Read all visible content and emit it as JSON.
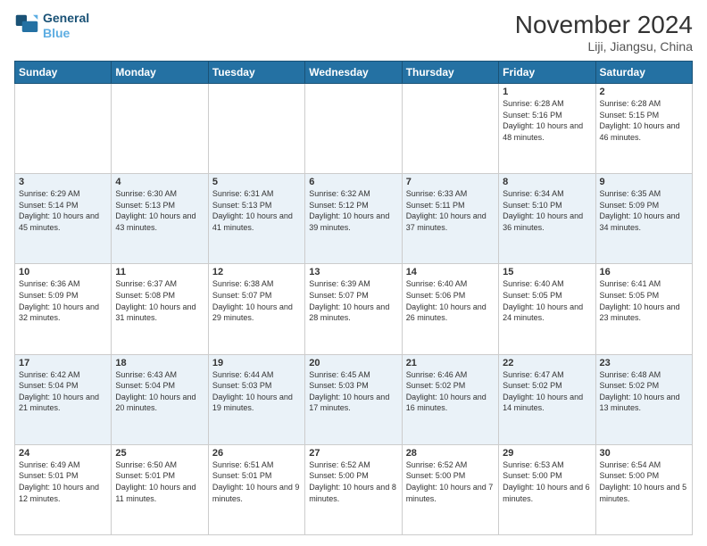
{
  "header": {
    "logo_line1": "General",
    "logo_line2": "Blue",
    "month_title": "November 2024",
    "location": "Liji, Jiangsu, China"
  },
  "days_of_week": [
    "Sunday",
    "Monday",
    "Tuesday",
    "Wednesday",
    "Thursday",
    "Friday",
    "Saturday"
  ],
  "weeks": [
    [
      {
        "day": "",
        "info": ""
      },
      {
        "day": "",
        "info": ""
      },
      {
        "day": "",
        "info": ""
      },
      {
        "day": "",
        "info": ""
      },
      {
        "day": "",
        "info": ""
      },
      {
        "day": "1",
        "info": "Sunrise: 6:28 AM\nSunset: 5:16 PM\nDaylight: 10 hours and 48 minutes."
      },
      {
        "day": "2",
        "info": "Sunrise: 6:28 AM\nSunset: 5:15 PM\nDaylight: 10 hours and 46 minutes."
      }
    ],
    [
      {
        "day": "3",
        "info": "Sunrise: 6:29 AM\nSunset: 5:14 PM\nDaylight: 10 hours and 45 minutes."
      },
      {
        "day": "4",
        "info": "Sunrise: 6:30 AM\nSunset: 5:13 PM\nDaylight: 10 hours and 43 minutes."
      },
      {
        "day": "5",
        "info": "Sunrise: 6:31 AM\nSunset: 5:13 PM\nDaylight: 10 hours and 41 minutes."
      },
      {
        "day": "6",
        "info": "Sunrise: 6:32 AM\nSunset: 5:12 PM\nDaylight: 10 hours and 39 minutes."
      },
      {
        "day": "7",
        "info": "Sunrise: 6:33 AM\nSunset: 5:11 PM\nDaylight: 10 hours and 37 minutes."
      },
      {
        "day": "8",
        "info": "Sunrise: 6:34 AM\nSunset: 5:10 PM\nDaylight: 10 hours and 36 minutes."
      },
      {
        "day": "9",
        "info": "Sunrise: 6:35 AM\nSunset: 5:09 PM\nDaylight: 10 hours and 34 minutes."
      }
    ],
    [
      {
        "day": "10",
        "info": "Sunrise: 6:36 AM\nSunset: 5:09 PM\nDaylight: 10 hours and 32 minutes."
      },
      {
        "day": "11",
        "info": "Sunrise: 6:37 AM\nSunset: 5:08 PM\nDaylight: 10 hours and 31 minutes."
      },
      {
        "day": "12",
        "info": "Sunrise: 6:38 AM\nSunset: 5:07 PM\nDaylight: 10 hours and 29 minutes."
      },
      {
        "day": "13",
        "info": "Sunrise: 6:39 AM\nSunset: 5:07 PM\nDaylight: 10 hours and 28 minutes."
      },
      {
        "day": "14",
        "info": "Sunrise: 6:40 AM\nSunset: 5:06 PM\nDaylight: 10 hours and 26 minutes."
      },
      {
        "day": "15",
        "info": "Sunrise: 6:40 AM\nSunset: 5:05 PM\nDaylight: 10 hours and 24 minutes."
      },
      {
        "day": "16",
        "info": "Sunrise: 6:41 AM\nSunset: 5:05 PM\nDaylight: 10 hours and 23 minutes."
      }
    ],
    [
      {
        "day": "17",
        "info": "Sunrise: 6:42 AM\nSunset: 5:04 PM\nDaylight: 10 hours and 21 minutes."
      },
      {
        "day": "18",
        "info": "Sunrise: 6:43 AM\nSunset: 5:04 PM\nDaylight: 10 hours and 20 minutes."
      },
      {
        "day": "19",
        "info": "Sunrise: 6:44 AM\nSunset: 5:03 PM\nDaylight: 10 hours and 19 minutes."
      },
      {
        "day": "20",
        "info": "Sunrise: 6:45 AM\nSunset: 5:03 PM\nDaylight: 10 hours and 17 minutes."
      },
      {
        "day": "21",
        "info": "Sunrise: 6:46 AM\nSunset: 5:02 PM\nDaylight: 10 hours and 16 minutes."
      },
      {
        "day": "22",
        "info": "Sunrise: 6:47 AM\nSunset: 5:02 PM\nDaylight: 10 hours and 14 minutes."
      },
      {
        "day": "23",
        "info": "Sunrise: 6:48 AM\nSunset: 5:02 PM\nDaylight: 10 hours and 13 minutes."
      }
    ],
    [
      {
        "day": "24",
        "info": "Sunrise: 6:49 AM\nSunset: 5:01 PM\nDaylight: 10 hours and 12 minutes."
      },
      {
        "day": "25",
        "info": "Sunrise: 6:50 AM\nSunset: 5:01 PM\nDaylight: 10 hours and 11 minutes."
      },
      {
        "day": "26",
        "info": "Sunrise: 6:51 AM\nSunset: 5:01 PM\nDaylight: 10 hours and 9 minutes."
      },
      {
        "day": "27",
        "info": "Sunrise: 6:52 AM\nSunset: 5:00 PM\nDaylight: 10 hours and 8 minutes."
      },
      {
        "day": "28",
        "info": "Sunrise: 6:52 AM\nSunset: 5:00 PM\nDaylight: 10 hours and 7 minutes."
      },
      {
        "day": "29",
        "info": "Sunrise: 6:53 AM\nSunset: 5:00 PM\nDaylight: 10 hours and 6 minutes."
      },
      {
        "day": "30",
        "info": "Sunrise: 6:54 AM\nSunset: 5:00 PM\nDaylight: 10 hours and 5 minutes."
      }
    ]
  ]
}
